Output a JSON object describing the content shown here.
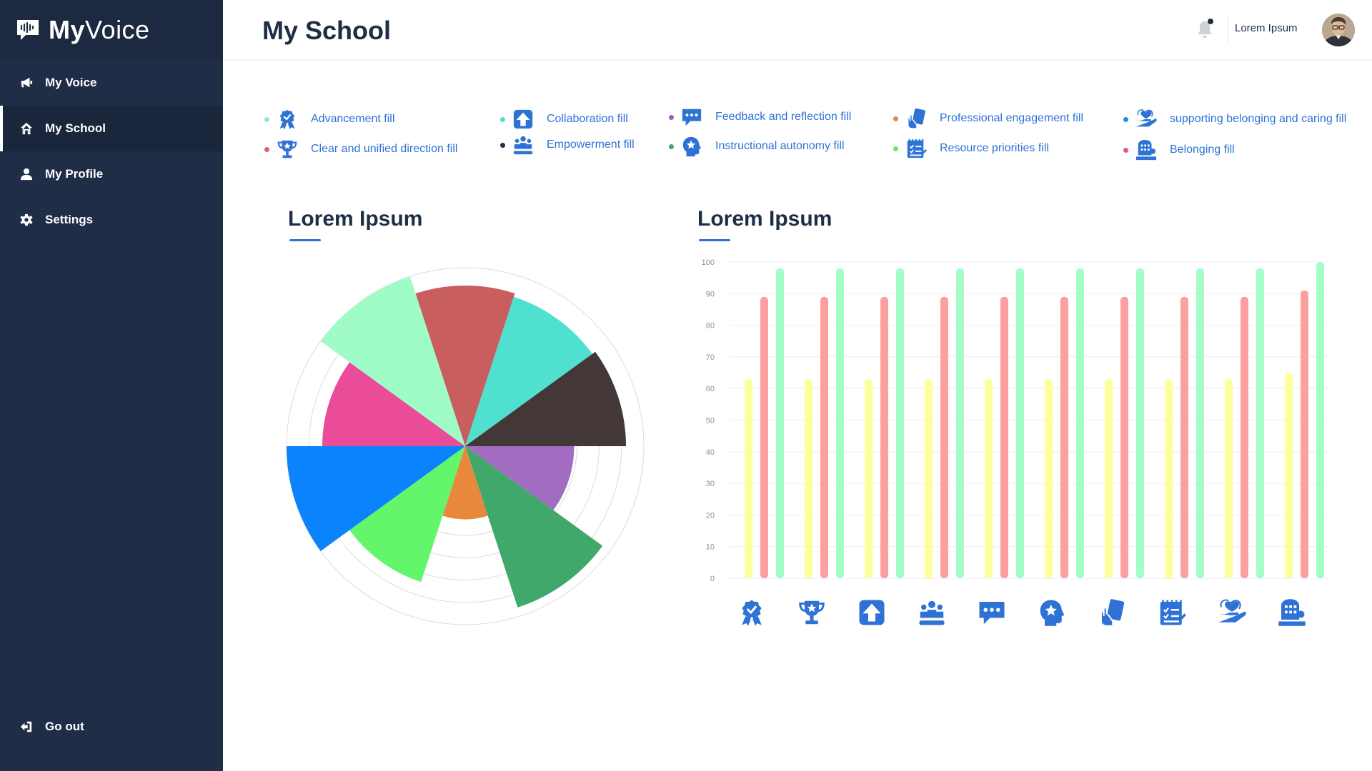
{
  "app": {
    "name_bold": "My",
    "name_light": "Voice"
  },
  "sidebar": {
    "items": [
      {
        "label": "My Voice",
        "icon": "megaphone-icon"
      },
      {
        "label": "My School",
        "icon": "home-icon",
        "active": true
      },
      {
        "label": "My Profile",
        "icon": "user-icon"
      },
      {
        "label": "Settings",
        "icon": "gear-icon"
      }
    ],
    "go_out": "Go out"
  },
  "header": {
    "title": "My School",
    "user": "Lorem Ipsum"
  },
  "legend": [
    {
      "label": "Advancement fill",
      "dot": "#8ef0b8",
      "icon": "award-icon"
    },
    {
      "label": "Clear and unified direction fill",
      "dot": "#e85b6c",
      "icon": "trophy-icon"
    },
    {
      "label": "Collaboration fill",
      "dot": "#4fe0cf",
      "icon": "arrow-up-icon"
    },
    {
      "label": "Empowerment fill",
      "dot": "#1e2e46",
      "icon": "people-icon"
    },
    {
      "label": "Feedback and reflection fill",
      "dot": "#a25cc0",
      "icon": "chat-icon"
    },
    {
      "label": "Instructional autonomy fill",
      "dot": "#3faa6a",
      "icon": "star-head-icon"
    },
    {
      "label": "Professional engagement fill",
      "dot": "#e68a35",
      "icon": "hand-card-icon"
    },
    {
      "label": "Resource priorities fill",
      "dot": "#66e86a",
      "icon": "checklist-icon"
    },
    {
      "label": "supporting belonging and caring fill",
      "dot": "#1e8cf5",
      "icon": "hand-heart-icon"
    },
    {
      "label": "Belonging fill",
      "dot": "#ee4c9c",
      "icon": "building-icon"
    }
  ],
  "charts": {
    "pie_title": "Lorem Ipsum",
    "bar_title": "Lorem Ipsum"
  },
  "chart_data": [
    {
      "type": "pie",
      "subtype": "polar-area",
      "rmax": 100,
      "rings": 8,
      "segments": [
        {
          "value": 90,
          "color": "#c85f5e"
        },
        {
          "value": 88,
          "color": "#4fe0cf"
        },
        {
          "value": 90,
          "color": "#433737"
        },
        {
          "value": 61,
          "color": "#a26cc0"
        },
        {
          "value": 95,
          "color": "#41a86b"
        },
        {
          "value": 41,
          "color": "#e8883a"
        },
        {
          "value": 80,
          "color": "#63f56a"
        },
        {
          "value": 100,
          "color": "#0a83fd"
        },
        {
          "value": 80,
          "color": "#ea4c9a"
        },
        {
          "value": 100,
          "color": "#a0fcc6"
        }
      ]
    },
    {
      "type": "bar",
      "ylim": [
        0,
        100
      ],
      "yticks": [
        0,
        10,
        20,
        30,
        40,
        50,
        60,
        70,
        80,
        90,
        100
      ],
      "categories": [
        "award-icon",
        "trophy-icon",
        "arrow-up-icon",
        "people-icon",
        "chat-icon",
        "star-head-icon",
        "hand-card-icon",
        "checklist-icon",
        "hand-heart-icon",
        "building-icon"
      ],
      "series": [
        {
          "color": "#fcff9a",
          "values": [
            63,
            63,
            63,
            63,
            63,
            63,
            63,
            63,
            63,
            65
          ]
        },
        {
          "color": "#fca09f",
          "values": [
            89,
            89,
            89,
            89,
            89,
            89,
            89,
            89,
            89,
            91
          ]
        },
        {
          "color": "#a4fcc7",
          "values": [
            98,
            98,
            98,
            98,
            98,
            98,
            98,
            98,
            98,
            100
          ]
        }
      ]
    }
  ]
}
